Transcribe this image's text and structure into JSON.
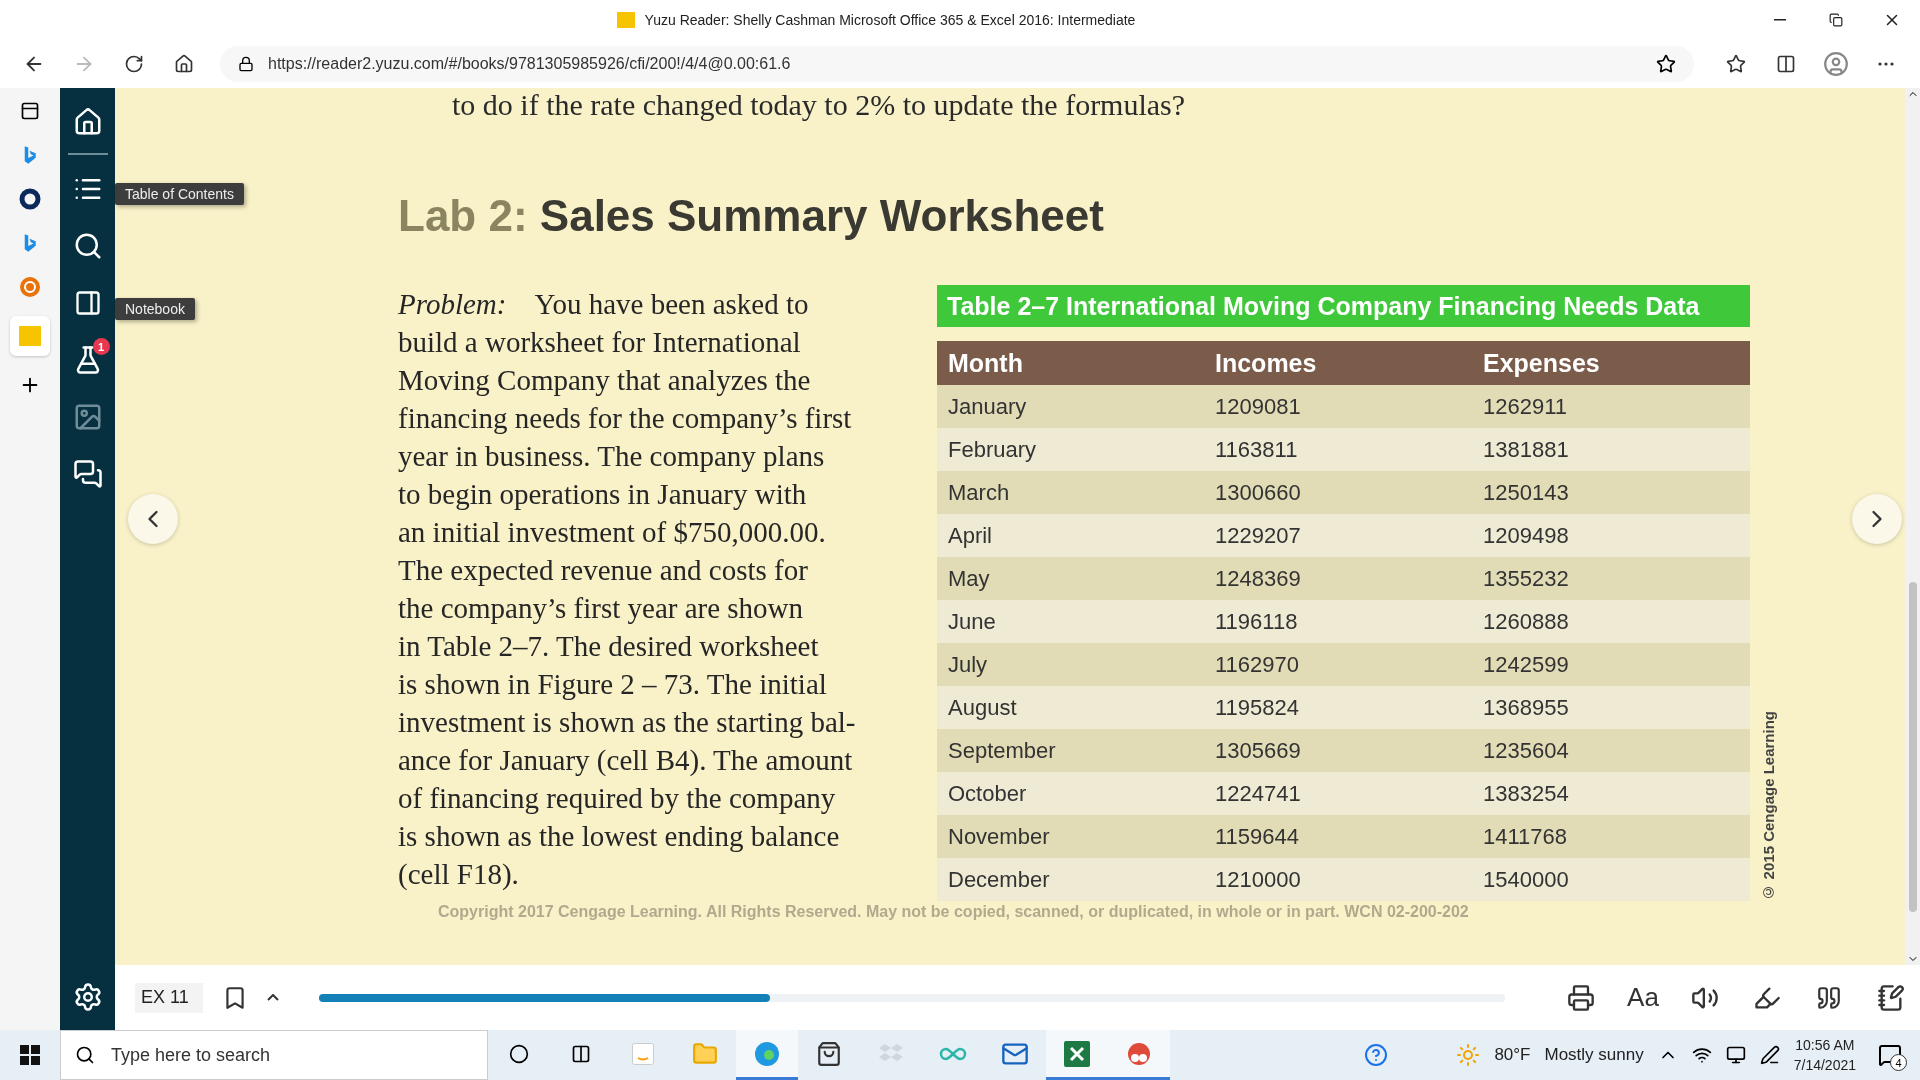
{
  "window": {
    "title": "Yuzu Reader: Shelly Cashman Microsoft Office 365 & Excel 2016: Intermediate"
  },
  "browser": {
    "url": "https://reader2.yuzu.com/#/books/9781305985926/cfi/200!/4/4@0.00:61.6"
  },
  "reader": {
    "tooltips": [
      "Table of Contents",
      "Notebook"
    ],
    "lab_badge": "1"
  },
  "page": {
    "intro_line": "to do if the rate changed today to 2% to update the formulas?",
    "heading_label": "Lab 2:",
    "heading_title": "Sales Summary Worksheet",
    "problem_lines": [
      "*Problem:*    You have been asked to",
      "build a worksheet for International",
      "Moving Company that analyzes the",
      "financing needs for the company’s first",
      "year in business. The company plans",
      "to begin operations in January with",
      "an initial investment of $750,000.00.",
      "The expected revenue and costs for",
      "the company’s first year are shown",
      "in Table 2–7. The desired worksheet",
      "is shown in Figure 2 – 73. The initial",
      "investment is shown as the starting bal-",
      "ance for January (cell B4). The amount",
      "of financing required by the company",
      "is shown as the lowest ending balance",
      "(cell F18)."
    ],
    "table": {
      "title": "Table 2–7 International Moving Company Financing Needs Data",
      "columns": [
        "Month",
        "Incomes",
        "Expenses"
      ],
      "rows": [
        [
          "January",
          "1209081",
          "1262911"
        ],
        [
          "February",
          "1163811",
          "1381881"
        ],
        [
          "March",
          "1300660",
          "1250143"
        ],
        [
          "April",
          "1229207",
          "1209498"
        ],
        [
          "May",
          "1248369",
          "1355232"
        ],
        [
          "June",
          "1196118",
          "1260888"
        ],
        [
          "July",
          "1162970",
          "1242599"
        ],
        [
          "August",
          "1195824",
          "1368955"
        ],
        [
          "September",
          "1305669",
          "1235604"
        ],
        [
          "October",
          "1224741",
          "1383254"
        ],
        [
          "November",
          "1159644",
          "1411768"
        ],
        [
          "December",
          "1210000",
          "1540000"
        ]
      ]
    },
    "side_credit": "© 2015 Cengage Learning",
    "copyright": "Copyright 2017 Cengage Learning. All Rights Reserved. May not be copied, scanned, or duplicated, in whole or in part.  WCN 02-200-202"
  },
  "bottom_bar": {
    "page_field": "EX 11",
    "progress": {
      "level": 0.38
    },
    "text_size": "Aa"
  },
  "taskbar": {
    "search_placeholder": "Type here to search",
    "temperature": "80°F",
    "weather": "Mostly sunny",
    "time": "10:56 AM",
    "date": "7/14/2021",
    "notifications": "4"
  }
}
